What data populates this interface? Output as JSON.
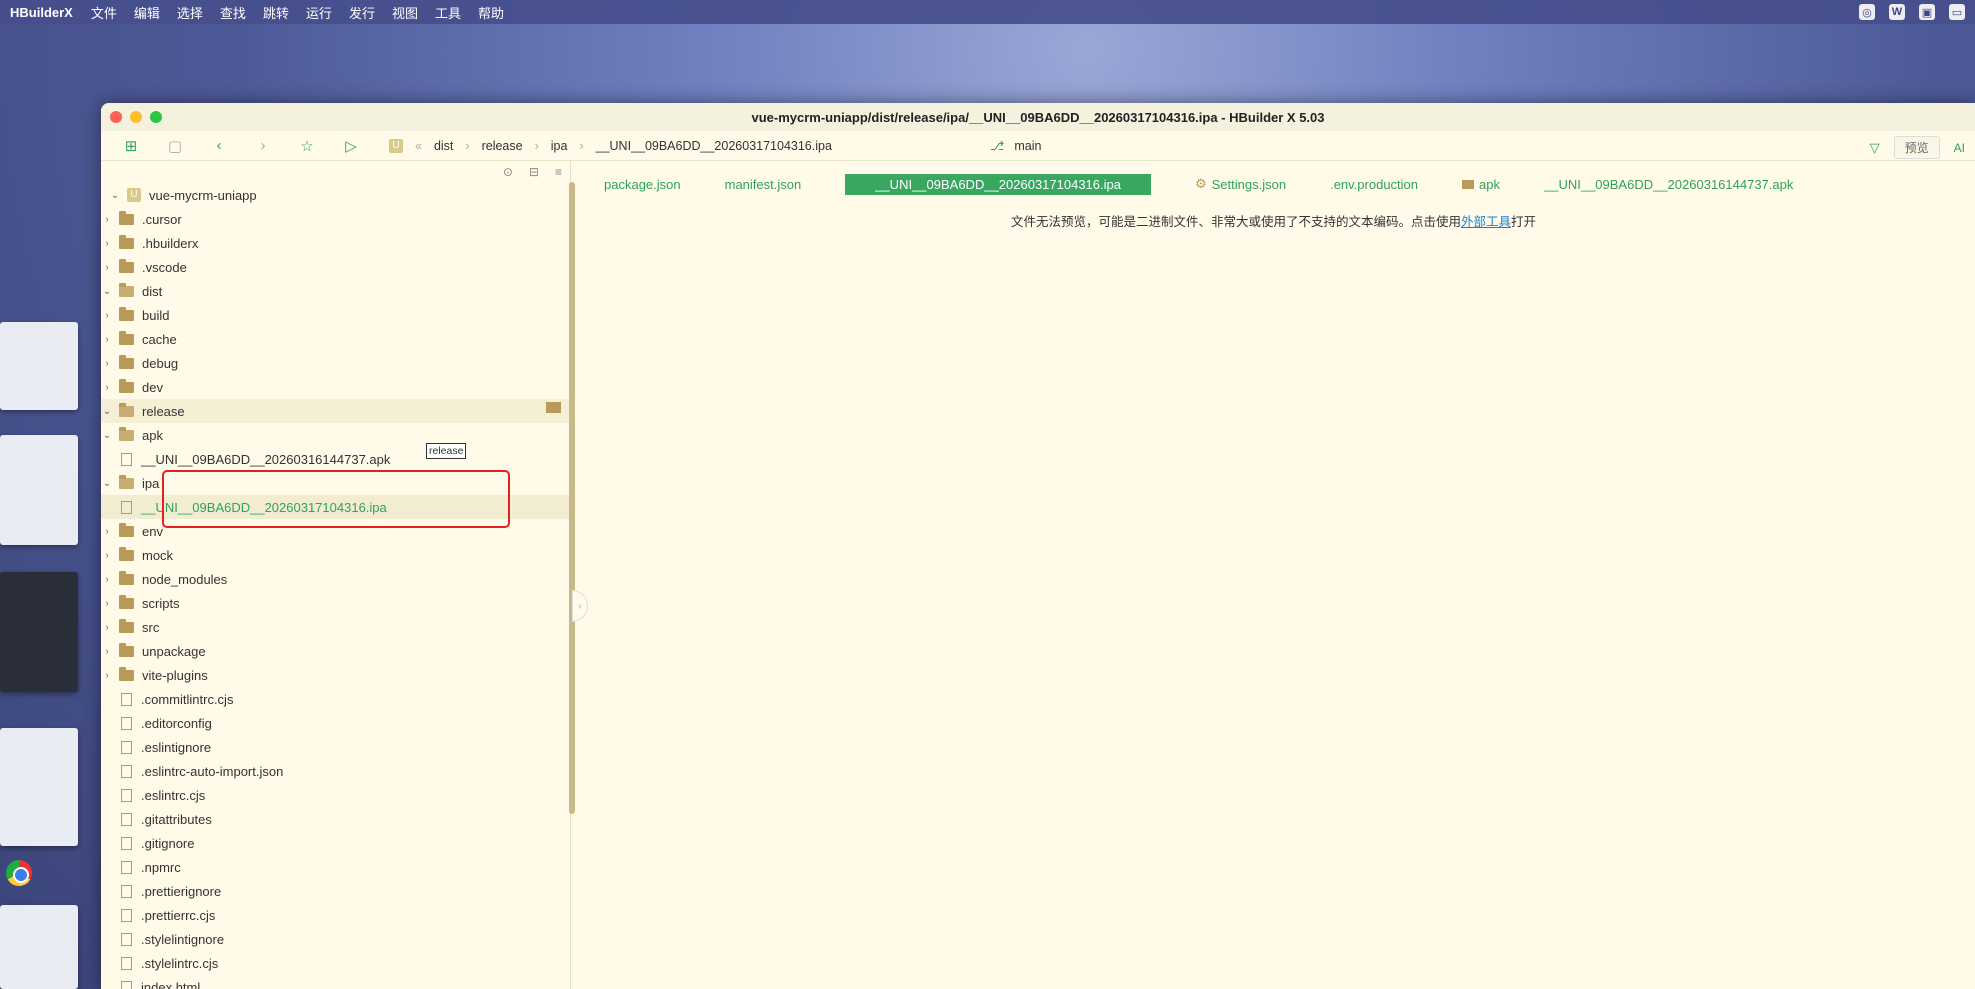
{
  "menubar": {
    "app": "HBuilderX",
    "items": [
      "文件",
      "编辑",
      "选择",
      "查找",
      "跳转",
      "运行",
      "发行",
      "视图",
      "工具",
      "帮助"
    ]
  },
  "window": {
    "title": "vue-mycrm-uniapp/dist/release/ipa/__UNI__09BA6DD__20260317104316.ipa - HBuilder X 5.03"
  },
  "toolbar": {
    "breadcrumb": [
      "dist",
      "release",
      "ipa",
      "__UNI__09BA6DD__20260317104316.ipa"
    ],
    "branch": "main",
    "preview_label": "预览",
    "ai_label": "AI"
  },
  "tree": {
    "root": "vue-mycrm-uniapp",
    "tooltip": "release",
    "rows": [
      {
        "label": ".cursor",
        "level": 1,
        "type": "folder",
        "state": "closed"
      },
      {
        "label": ".hbuilderx",
        "level": 1,
        "type": "folder",
        "state": "closed"
      },
      {
        "label": ".vscode",
        "level": 1,
        "type": "folder",
        "state": "closed"
      },
      {
        "label": "dist",
        "level": 1,
        "type": "folder",
        "state": "open"
      },
      {
        "label": "build",
        "level": 2,
        "type": "folder",
        "state": "closed"
      },
      {
        "label": "cache",
        "level": 2,
        "type": "folder",
        "state": "closed"
      },
      {
        "label": "debug",
        "level": 2,
        "type": "folder",
        "state": "closed"
      },
      {
        "label": "dev",
        "level": 2,
        "type": "folder",
        "state": "closed"
      },
      {
        "label": "release",
        "level": 2,
        "type": "folder",
        "state": "open"
      },
      {
        "label": "apk",
        "level": 3,
        "type": "folder",
        "state": "open"
      },
      {
        "label": "__UNI__09BA6DD__20260316144737.apk",
        "level": 4,
        "type": "file",
        "state": ""
      },
      {
        "label": "ipa",
        "level": 3,
        "type": "folder",
        "state": "open"
      },
      {
        "label": "__UNI__09BA6DD__20260317104316.ipa",
        "level": 4,
        "type": "file",
        "state": "active"
      },
      {
        "label": "env",
        "level": 1,
        "type": "folder",
        "state": "closed"
      },
      {
        "label": "mock",
        "level": 1,
        "type": "folder",
        "state": "closed"
      },
      {
        "label": "node_modules",
        "level": 1,
        "type": "folder",
        "state": "closed"
      },
      {
        "label": "scripts",
        "level": 1,
        "type": "folder",
        "state": "closed"
      },
      {
        "label": "src",
        "level": 1,
        "type": "folder",
        "state": "closed"
      },
      {
        "label": "unpackage",
        "level": 1,
        "type": "folder",
        "state": "closed"
      },
      {
        "label": "vite-plugins",
        "level": 1,
        "type": "folder",
        "state": "closed"
      },
      {
        "label": ".commitlintrc.cjs",
        "level": 1,
        "type": "file",
        "state": ""
      },
      {
        "label": ".editorconfig",
        "level": 1,
        "type": "file",
        "state": ""
      },
      {
        "label": ".eslintignore",
        "level": 1,
        "type": "file",
        "state": ""
      },
      {
        "label": ".eslintrc-auto-import.json",
        "level": 1,
        "type": "file",
        "state": ""
      },
      {
        "label": ".eslintrc.cjs",
        "level": 1,
        "type": "file",
        "state": ""
      },
      {
        "label": ".gitattributes",
        "level": 1,
        "type": "file",
        "state": ""
      },
      {
        "label": ".gitignore",
        "level": 1,
        "type": "file",
        "state": ""
      },
      {
        "label": ".npmrc",
        "level": 1,
        "type": "file",
        "state": ""
      },
      {
        "label": ".prettierignore",
        "level": 1,
        "type": "file",
        "state": ""
      },
      {
        "label": ".prettierrc.cjs",
        "level": 1,
        "type": "file",
        "state": ""
      },
      {
        "label": ".stylelintignore",
        "level": 1,
        "type": "file",
        "state": ""
      },
      {
        "label": ".stylelintrc.cjs",
        "level": 1,
        "type": "file",
        "state": ""
      },
      {
        "label": "index.html",
        "level": 1,
        "type": "file",
        "state": ""
      }
    ]
  },
  "editor": {
    "tabs": [
      {
        "label": "package.json",
        "active": false,
        "icon": ""
      },
      {
        "label": "manifest.json",
        "active": false,
        "icon": ""
      },
      {
        "label": "__UNI__09BA6DD__20260317104316.ipa",
        "active": true,
        "icon": ""
      },
      {
        "label": "Settings.json",
        "active": false,
        "icon": "gear-icon"
      },
      {
        "label": ".env.production",
        "active": false,
        "icon": ""
      },
      {
        "label": "apk",
        "active": false,
        "icon": "folder-icon"
      },
      {
        "label": "__UNI__09BA6DD__20260316144737.apk",
        "active": false,
        "icon": ""
      }
    ],
    "message_before": "文件无法预览，可能是二进制文件、非常大或使用了不支持的文本编码。点击使用",
    "message_link": "外部工具",
    "message_after": "打开"
  },
  "colors": {
    "accent": "#3aa760",
    "highlight_box": "#e62020",
    "background": "#fffbe8"
  }
}
